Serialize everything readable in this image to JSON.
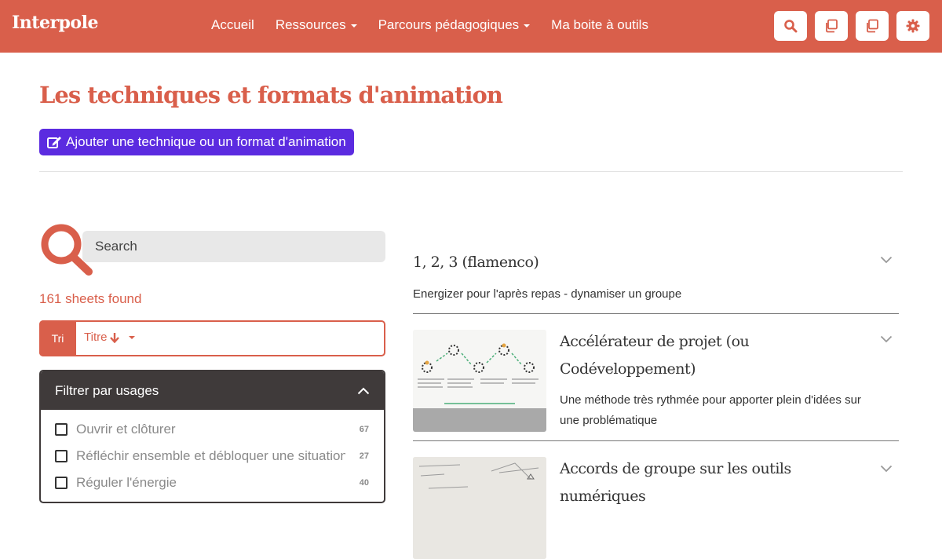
{
  "header": {
    "brand": "Interpole",
    "nav": [
      {
        "label": "Accueil",
        "dropdown": false
      },
      {
        "label": "Ressources",
        "dropdown": true
      },
      {
        "label": "Parcours pédagogiques",
        "dropdown": true
      },
      {
        "label": "Ma boite à outils",
        "dropdown": false
      }
    ],
    "buttons": [
      "search-icon",
      "copy-icon",
      "copy-icon",
      "gear-icon"
    ],
    "color": "#d95f4b"
  },
  "main": {
    "title": "Les techniques et formats d'animation",
    "add_button": "Ajouter une technique ou un format d'animation",
    "add_button_color": "#5b2be0"
  },
  "search": {
    "placeholder": "Search"
  },
  "results_count": "161 sheets found",
  "sort": {
    "label": "Tri",
    "value": "Titre"
  },
  "filter": {
    "title": "Filtrer par usages",
    "items": [
      {
        "label": "Ouvrir et clôturer",
        "count": "67"
      },
      {
        "label": "Réfléchir ensemble et débloquer une situation",
        "count": "27"
      },
      {
        "label": "Réguler l'énergie",
        "count": "40"
      }
    ]
  },
  "results": [
    {
      "title": "1, 2, 3 (flamenco)",
      "description": "Energizer pour l'après repas - dynamiser un groupe"
    },
    {
      "title_lines": [
        "Accélérateur de projet (ou",
        "Codéveloppement)"
      ],
      "description_lines": [
        "Une méthode très rythmée pour apporter plein d'idées sur",
        "une problématique"
      ]
    },
    {
      "title_lines": [
        "Accords de groupe sur les outils",
        "numériques"
      ]
    }
  ]
}
